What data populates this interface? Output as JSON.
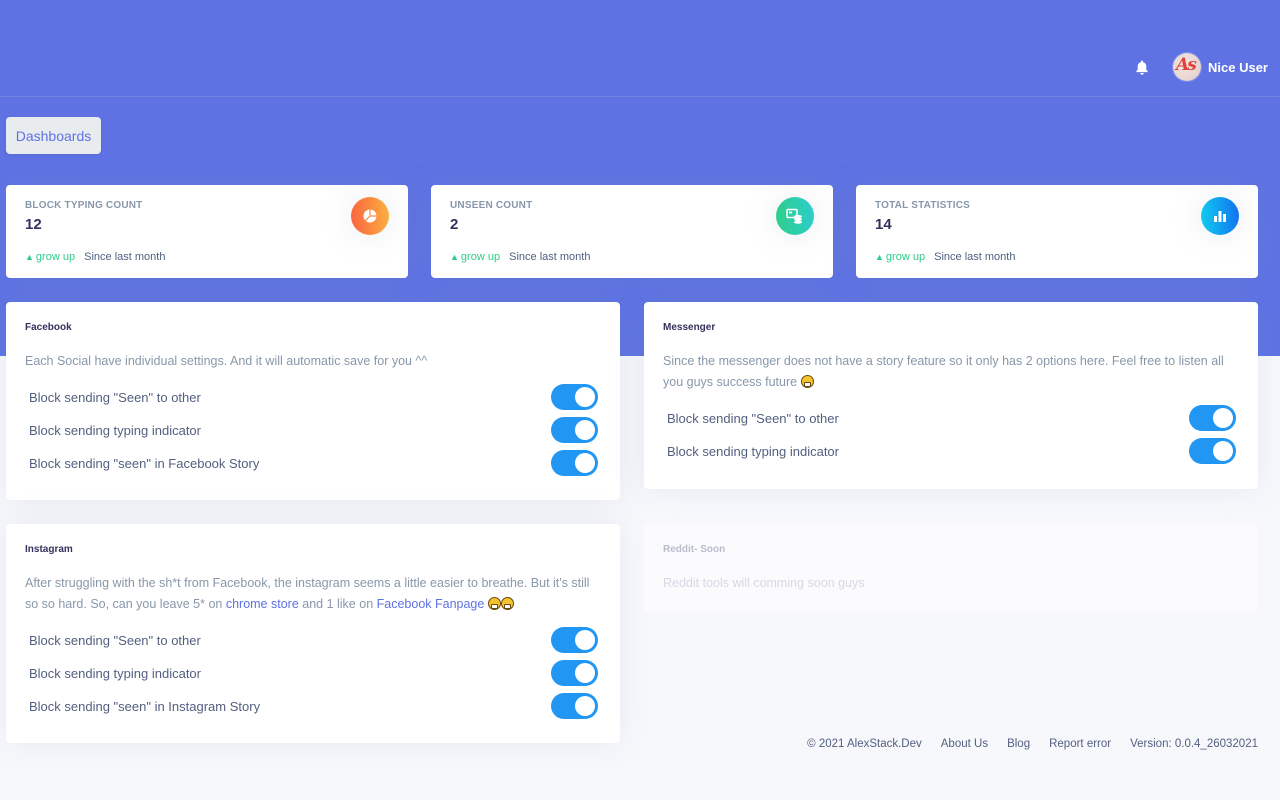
{
  "header": {
    "user_name": "Nice User",
    "avatar_initials": "As",
    "notification_icon": "bell-icon"
  },
  "breadcrumb": {
    "dashboards_label": "Dashboards"
  },
  "stats": [
    {
      "title": "BLOCK TYPING COUNT",
      "value": "12",
      "trend_label": "grow up",
      "since": "Since last month",
      "icon": "pie-chart-icon",
      "color": "#fb6340"
    },
    {
      "title": "UNSEEN COUNT",
      "value": "2",
      "trend_label": "grow up",
      "since": "Since last month",
      "icon": "database-icon",
      "color": "#2dce89"
    },
    {
      "title": "TOTAL STATISTICS",
      "value": "14",
      "trend_label": "grow up",
      "since": "Since last month",
      "icon": "bar-chart-icon",
      "color": "#11cdef"
    }
  ],
  "panels": {
    "facebook": {
      "title": "Facebook",
      "description": "Each Social have individual settings. And it will automatic save for you ^^",
      "options": [
        {
          "label": "Block sending \"Seen\" to other",
          "enabled": true
        },
        {
          "label": "Block sending typing indicator",
          "enabled": true
        },
        {
          "label": "Block sending \"seen\" in Facebook Story",
          "enabled": true
        }
      ]
    },
    "messenger": {
      "title": "Messenger",
      "description": "Since the messenger does not have a story feature so it only has 2 options here. Feel free to listen all you guys success future",
      "options": [
        {
          "label": "Block sending \"Seen\" to other",
          "enabled": true
        },
        {
          "label": "Block sending typing indicator",
          "enabled": true
        }
      ]
    },
    "instagram": {
      "title": "Instagram",
      "description_prefix": "After struggling with the sh*t from Facebook, the instagram seems a little easier to breathe. But it's still so so hard. So, can you leave 5* on ",
      "link_chrome_store": "chrome store",
      "description_middle": " and 1 like on ",
      "link_fanpage": "Facebook Fanpage",
      "options": [
        {
          "label": "Block sending \"Seen\" to other",
          "enabled": true
        },
        {
          "label": "Block sending typing indicator",
          "enabled": true
        },
        {
          "label": "Block sending \"seen\" in Instagram Story",
          "enabled": true
        }
      ]
    },
    "reddit": {
      "title": "Reddit- Soon",
      "description": "Reddit tools will comming soon guys"
    }
  },
  "footer": {
    "copyright": "© 2021 AlexStack.Dev",
    "about": "About Us",
    "blog": "Blog",
    "report": "Report error",
    "version": "Version: 0.0.4_26032021"
  },
  "colors": {
    "primary": "#5e72e4",
    "toggle_on": "#2196f3",
    "success": "#2dce89"
  }
}
